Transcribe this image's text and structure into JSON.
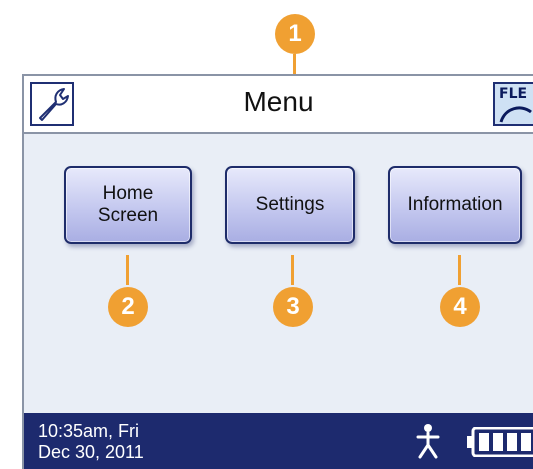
{
  "header": {
    "title": "Menu",
    "left_icon": "wrench-icon",
    "right_icon": "flex-icon",
    "right_label": "FLE"
  },
  "menu_buttons": [
    {
      "label_line1": "Home",
      "label_line2": "Screen"
    },
    {
      "label": "Settings"
    },
    {
      "label": "Information"
    }
  ],
  "status": {
    "time_line1": "10:35am, Fri",
    "time_line2": "Dec 30, 2011",
    "person_icon": "person-icon",
    "battery_icon": "battery-icon"
  },
  "callouts": [
    "1",
    "2",
    "3",
    "4"
  ],
  "colors": {
    "callout": "#f0a032",
    "statusbar": "#1d2a6e",
    "button_border": "#1e2c6a"
  }
}
